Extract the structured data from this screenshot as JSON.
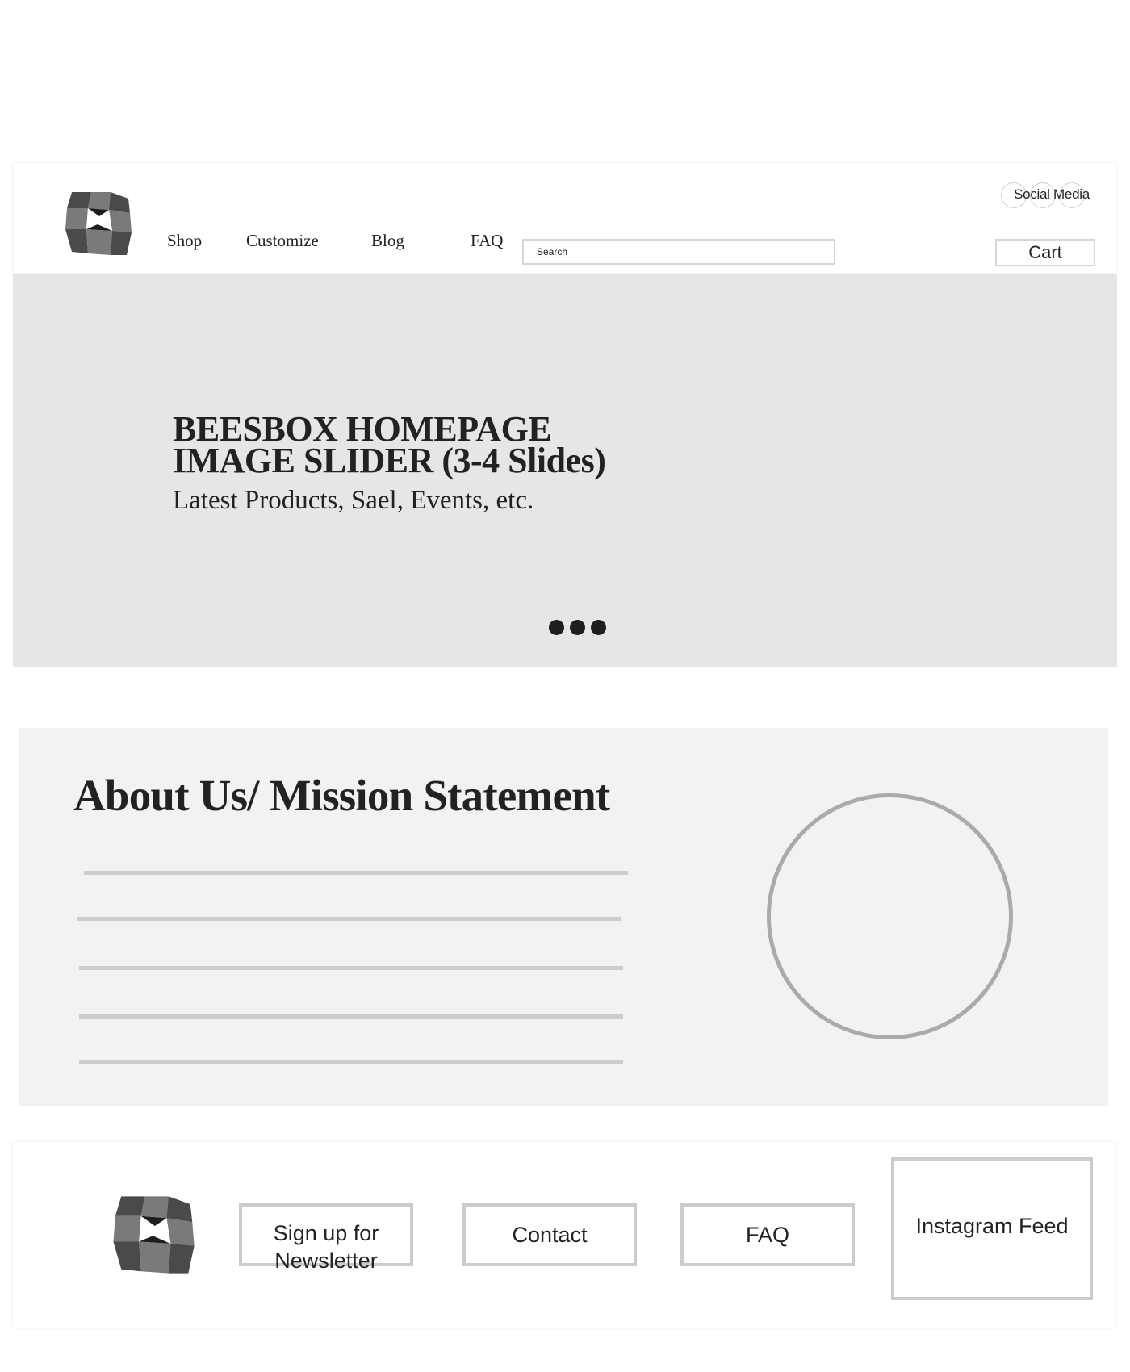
{
  "header": {
    "logo_icon": "beesbox-cube-logo",
    "nav": [
      {
        "label": "Shop"
      },
      {
        "label": "Customize"
      },
      {
        "label": "Blog"
      },
      {
        "label": "FAQ"
      }
    ],
    "search": {
      "placeholder": "Search"
    },
    "social_label": "Social Media",
    "cart_label": "Cart"
  },
  "hero": {
    "title_line1": "BEESBOX HOMEPAGE",
    "title_line2": "IMAGE SLIDER (3-4 Slides)",
    "subtitle": "Latest Products, Sael, Events, etc.",
    "slide_count": 3
  },
  "about": {
    "title": "About Us/ Mission Statement",
    "placeholder_lines": 5,
    "image_placeholder": "circle"
  },
  "footer": {
    "logo_icon": "beesbox-cube-logo",
    "newsletter_line1": "Sign up for",
    "newsletter_line2": "Newsletter",
    "contact_label": "Contact",
    "faq_label": "FAQ",
    "instagram_label": "Instagram Feed"
  },
  "colors": {
    "hero_bg": "#e6e6e6",
    "about_bg": "#f2f2f2",
    "border": "#cccccc",
    "text": "#222222"
  }
}
